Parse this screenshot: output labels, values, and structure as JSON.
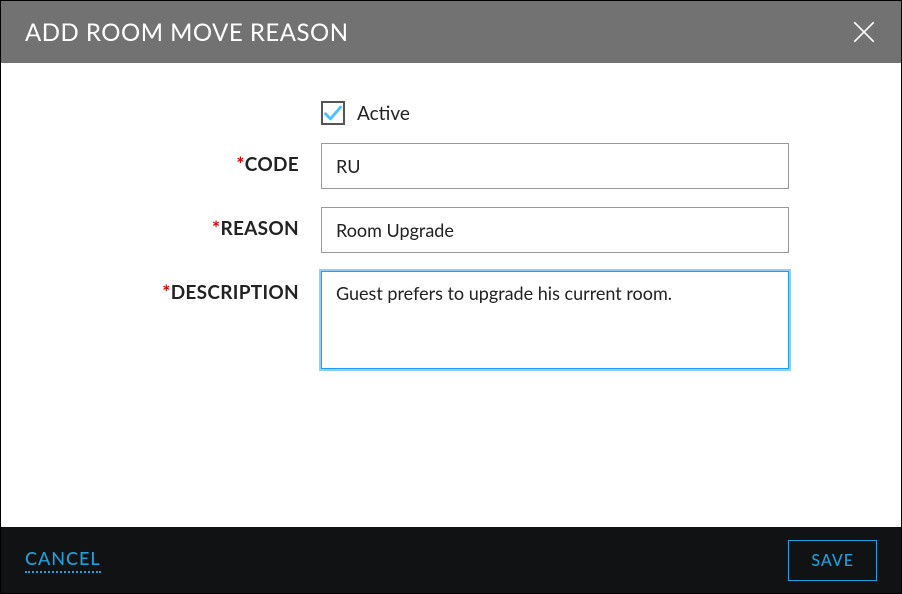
{
  "header": {
    "title": "ADD ROOM MOVE REASON"
  },
  "form": {
    "active": {
      "label": "Active",
      "checked": true
    },
    "code": {
      "label": "CODE",
      "value": "RU"
    },
    "reason": {
      "label": "REASON",
      "value": "Room Upgrade"
    },
    "description": {
      "label": "DESCRIPTION",
      "value": "Guest prefers to upgrade his current room."
    }
  },
  "footer": {
    "cancel": "CANCEL",
    "save": "SAVE"
  }
}
